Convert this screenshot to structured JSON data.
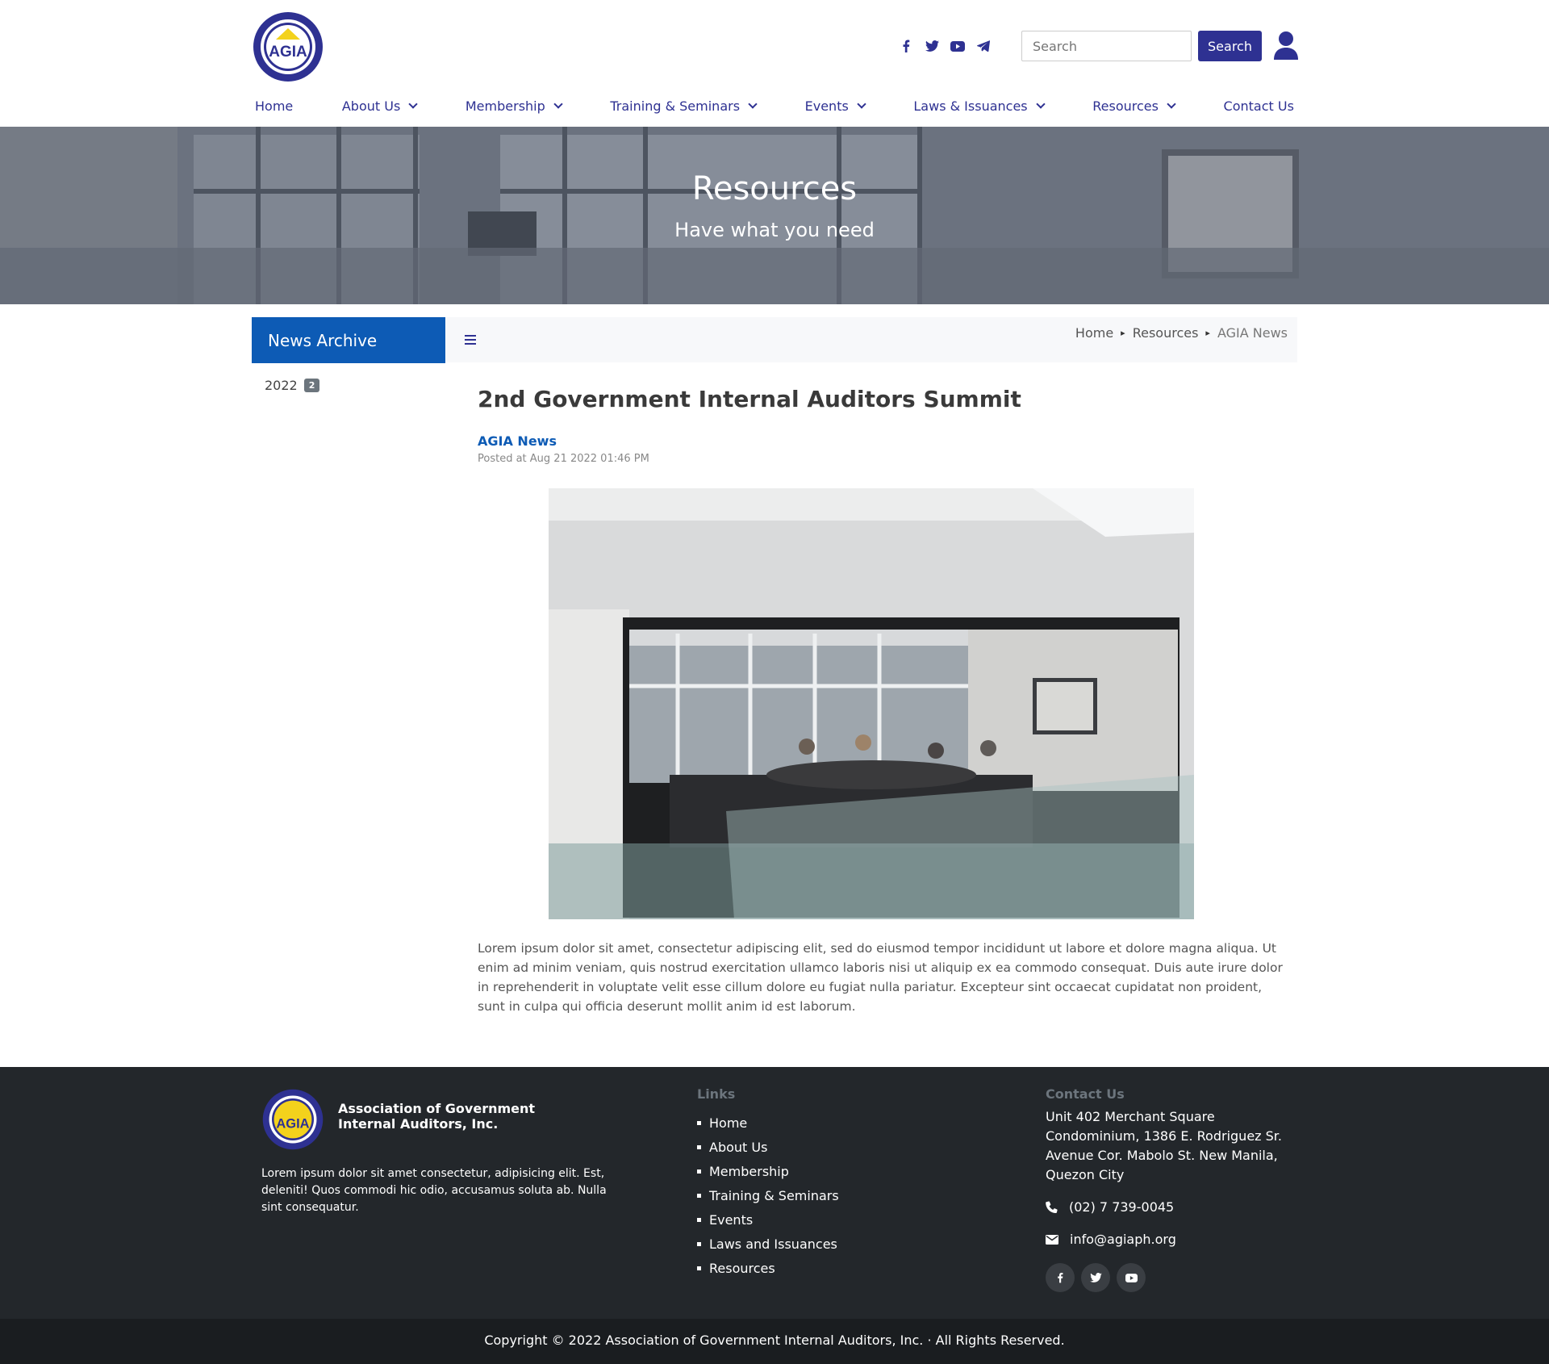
{
  "header": {
    "logo_text": "AGIA",
    "search": {
      "placeholder": "Search",
      "button_label": "Search"
    },
    "social_icons": [
      "facebook-icon",
      "twitter-icon",
      "youtube-icon",
      "telegram-icon"
    ]
  },
  "nav": {
    "items": [
      {
        "label": "Home",
        "dropdown": false
      },
      {
        "label": "About Us",
        "dropdown": true
      },
      {
        "label": "Membership",
        "dropdown": true
      },
      {
        "label": "Training & Seminars",
        "dropdown": true
      },
      {
        "label": "Events",
        "dropdown": true
      },
      {
        "label": "Laws & Issuances",
        "dropdown": true
      },
      {
        "label": "Resources",
        "dropdown": true
      },
      {
        "label": "Contact Us",
        "dropdown": false
      }
    ]
  },
  "hero": {
    "title": "Resources",
    "subtitle": "Have what you need"
  },
  "sidebar": {
    "heading": "News Archive",
    "archive": [
      {
        "year": "2022",
        "count": "2"
      }
    ]
  },
  "breadcrumb": {
    "items": [
      "Home",
      "Resources"
    ],
    "current": "AGIA News"
  },
  "article": {
    "title": "2nd Government Internal Auditors Summit",
    "category": "AGIA News",
    "posted": "Posted at Aug 21 2022 01:46 PM",
    "body": "Lorem ipsum dolor sit amet, consectetur adipiscing elit, sed do eiusmod tempor incididunt ut labore et dolore magna aliqua. Ut enim ad minim veniam, quis nostrud exercitation ullamco laboris nisi ut aliquip ex ea commodo consequat. Duis aute irure dolor in reprehenderit in voluptate velit esse cillum dolore eu fugiat nulla pariatur. Excepteur sint occaecat cupidatat non proident, sunt in culpa qui officia deserunt mollit anim id est laborum."
  },
  "footer": {
    "org_name": "Association of Government Internal Auditors, Inc.",
    "description": "Lorem ipsum dolor sit amet consectetur, adipisicing elit. Est, deleniti! Quos commodi hic odio, accusamus soluta ab. Nulla sint consequatur.",
    "links_heading": "Links",
    "links": [
      "Home",
      "About Us",
      "Membership",
      "Training & Seminars",
      "Events",
      "Laws and Issuances",
      "Resources"
    ],
    "contact_heading": "Contact Us",
    "address": "Unit 402 Merchant Square Condominium, 1386 E. Rodriguez Sr. Avenue Cor. Mabolo St. New Manila, Quezon City",
    "phone": "(02) 7 739-0045",
    "email": "info@agiaph.org",
    "copyright": "Copyright © 2022 Association of Government Internal Auditors, Inc. · All Rights Reserved."
  },
  "colors": {
    "brand": "#2e3192",
    "accent": "#0d5bb5",
    "footer_bg": "#23272b",
    "copyright_bg": "#1a1d20"
  }
}
